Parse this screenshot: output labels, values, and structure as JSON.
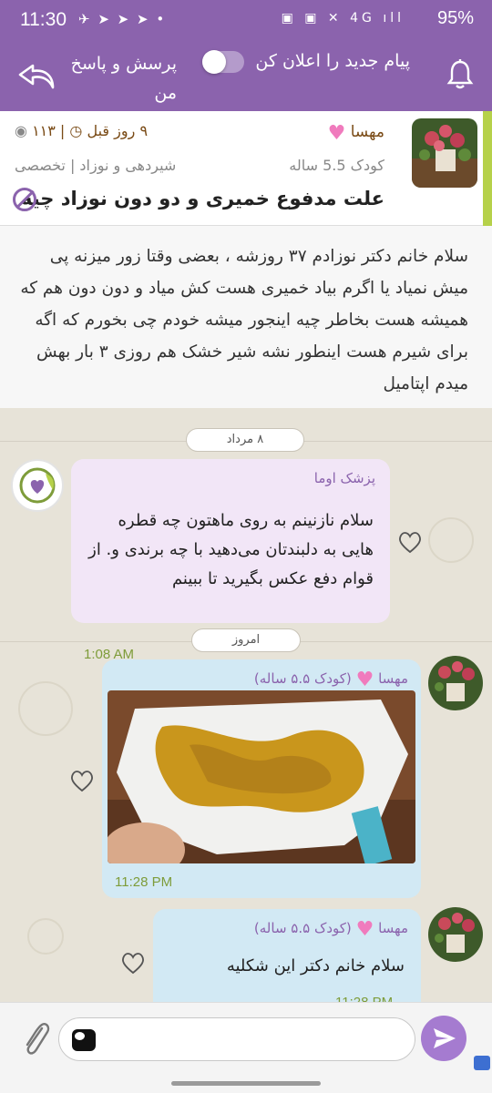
{
  "status_bar": {
    "time": "11:30",
    "left_icons": "✈ ➤ ➤ ➤ •",
    "right_icons": "▣ ▣ ✕ 4G ıll",
    "battery": "95%"
  },
  "header": {
    "notify_label": "پیام جدید را اعلان کن",
    "section_title": "پرسش و پاسخ من",
    "toggle_on": false
  },
  "question": {
    "user_name": "مهسا",
    "child_info": "کودک 5.5 ساله",
    "time_ago": "۹ روز قبل",
    "views": "۱۱۳",
    "category": "شیردهی و نوزاد | تخصصی",
    "title": "علت مدفوع خمیری و دو دون نوزاد چیه",
    "body": "سلام خانم دکتر  نوزادم ۳۷ روزشه ، بعضی وقتا زور میزنه پی میش نمیاد یا اگرم بیاد خمیری هست کش میاد و دون دون هم که همیشه هست بخاطر چیه اینجور میشه خودم چی بخورم که اگه برای شیرم هست اینطور نشه شیر خشک هم روزی ۳ بار بهش میدم اپتامیل"
  },
  "chat": {
    "date_1": "۸ مرداد",
    "date_2": "امروز",
    "doctor": {
      "name": "پزشک اوما",
      "message": "سلام نازنینم به روی ماهتون چه قطره هایی به دلبندتان می‌دهید با چه برندی و. از قوام دفع عکس بگیرید تا ببینم",
      "time": "1:08 AM"
    },
    "user_messages": [
      {
        "sender": "مهسا",
        "child_tag": "(کودک ۵.۵ ساله)",
        "type": "image",
        "time": "11:28 PM"
      },
      {
        "sender": "مهسا",
        "child_tag": "(کودک ۵.۵ ساله)",
        "text": "سلام خانم دکتر این شکلیه",
        "time": "11:28 PM"
      }
    ]
  },
  "composer": {
    "placeholder": ""
  },
  "colors": {
    "brand": "#8b63ad",
    "accent_green": "#b6d14a",
    "doctor_bubble": "#f2e6f7",
    "user_bubble": "#d2e9f4",
    "time_green": "#7e9c3a"
  }
}
